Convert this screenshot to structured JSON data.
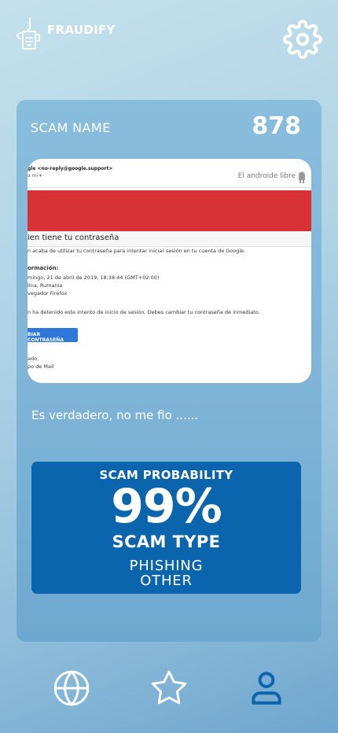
{
  "app": {
    "name": "FRAUDIFY"
  },
  "card": {
    "title": "SCAM NAME",
    "count": "878",
    "caption": "Es verdadero, no me fio ......"
  },
  "email_screenshot": {
    "from_line": "gle <no-reply@google.support>",
    "to_line": "a mí ▾",
    "brand": "El androide libre",
    "subtitle": "ien tiene tu contraseña",
    "lines": [
      "n acaba de utilizar tu contraseña para intentar iniciar sesión en tu cuenta de Google.",
      "ormación:",
      "mingo, 21 de abril de 2019, 18:38:44 (GMT+02:00)",
      "lina, Rumania",
      "vegador Firefox",
      "n ha detenido este intento de inicio de sesión. Debes cambiar tu contraseña de inmediato.",
      "ado,",
      "po de Mail"
    ],
    "button": "BIAR CONTRASEÑA"
  },
  "result": {
    "probability_label": "SCAM PROBABILITY",
    "probability_value": "99%",
    "type_label": "SCAM TYPE",
    "types": [
      "PHISHING",
      "OTHER"
    ]
  },
  "nav": {
    "items": [
      {
        "icon": "globe-icon",
        "active": false
      },
      {
        "icon": "star-icon",
        "active": false
      },
      {
        "icon": "user-icon",
        "active": true
      }
    ]
  },
  "colors": {
    "result_bg": "#0b65ac",
    "nav_active": "#0b65ac",
    "nav_inactive": "#ffffff",
    "email_banner": "#d93236"
  }
}
